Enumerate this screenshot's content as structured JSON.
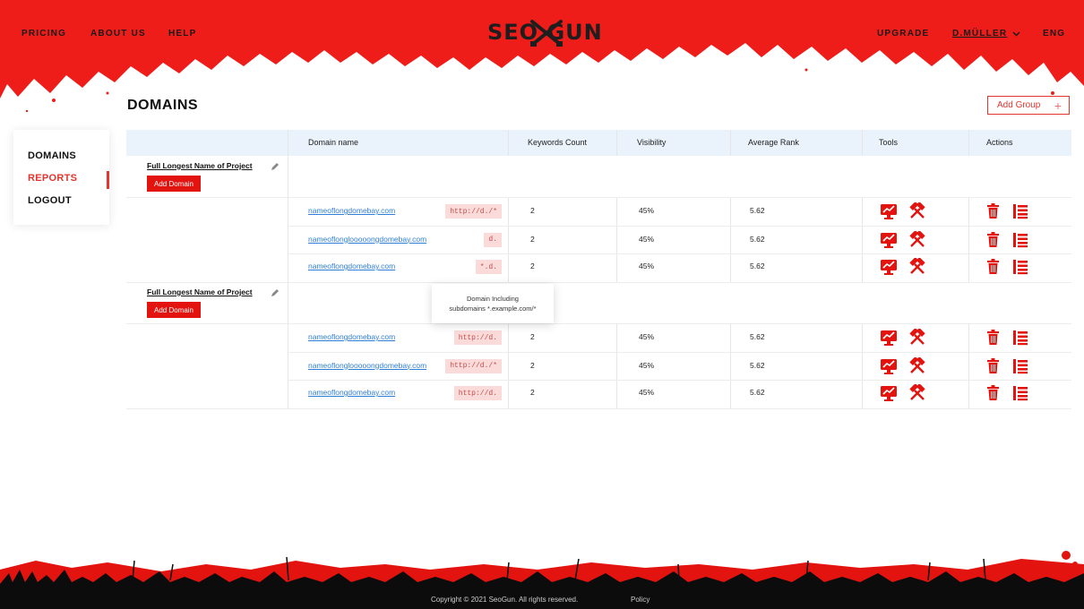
{
  "header": {
    "nav": [
      "PRICING",
      "ABOUT US",
      "HELP"
    ],
    "logo": "SEO GUN",
    "upgrade": "UPGRADE",
    "user": "D.MÜLLER",
    "language": "ENG"
  },
  "page_title": "DOMAINS",
  "add_group_label": "Add Group",
  "sidebar": {
    "items": [
      {
        "label": "DOMAINS",
        "active": false
      },
      {
        "label": "REPORTS",
        "active": true
      },
      {
        "label": "LOGOUT",
        "active": false
      }
    ]
  },
  "table": {
    "columns": [
      "Domain name",
      "Keywords Count",
      "Visibility",
      "Average Rank",
      "Tools",
      "Actions"
    ],
    "projects": [
      {
        "name": "Full Longest Name of Project",
        "add_domain_label": "Add Domain",
        "rows": [
          {
            "domain": "nameoflongdomebay.com",
            "badge": "http://d./*",
            "keywords": "2",
            "visibility": "45%",
            "avg_rank": "5.62"
          },
          {
            "domain": "nameoflonglooooongdomebay.com",
            "badge": "d.",
            "keywords": "2",
            "visibility": "45%",
            "avg_rank": "5.62"
          },
          {
            "domain": "nameoflongdomebay.com",
            "badge": "*.d.",
            "keywords": "2",
            "visibility": "45%",
            "avg_rank": "5.62"
          }
        ]
      },
      {
        "name": "Full Longest Name of Project",
        "add_domain_label": "Add Domain",
        "rows": [
          {
            "domain": "nameoflongdomebay.com",
            "badge": "http://d.",
            "keywords": "2",
            "visibility": "45%",
            "avg_rank": "5.62"
          },
          {
            "domain": "nameoflonglooooongdomebay.com",
            "badge": "http://d./*",
            "keywords": "2",
            "visibility": "45%",
            "avg_rank": "5.62"
          },
          {
            "domain": "nameoflongdomebay.com",
            "badge": "http://d.",
            "keywords": "2",
            "visibility": "45%",
            "avg_rank": "5.62"
          }
        ]
      }
    ]
  },
  "tooltip": {
    "line1": "Domain Including",
    "line2": "subdomains *.example.com/*"
  },
  "footer": {
    "copyright": "Copyright © 2021 SeoGun. All rights reserved.",
    "policy": "Policy"
  },
  "icons": {
    "tools": [
      "monitor-chart-icon",
      "crossed-hammers-icon"
    ],
    "actions": [
      "trash-icon",
      "list-icon"
    ],
    "edit": "pencil-icon",
    "user_menu": "chevron-down-icon"
  },
  "colors": {
    "brand_red": "#e3140f",
    "link_blue": "#2f7fd8",
    "header_row_bg": "#eaf3fb",
    "badge_bg": "#fbdada"
  }
}
